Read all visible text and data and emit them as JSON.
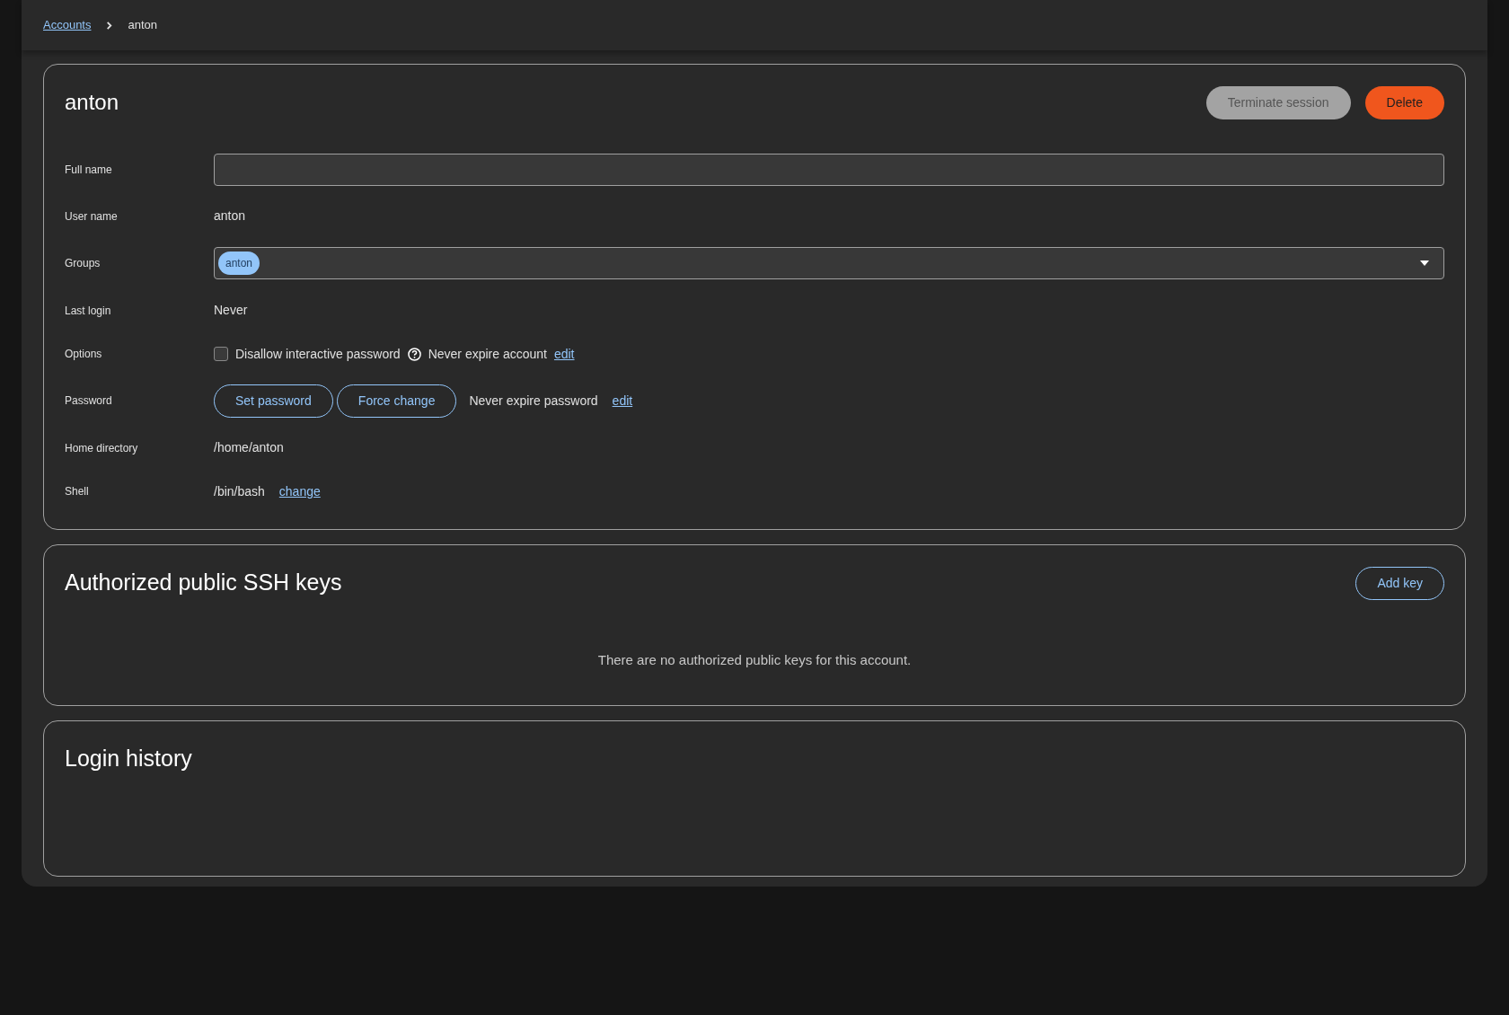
{
  "breadcrumb": {
    "link": "Accounts",
    "current": "anton"
  },
  "account": {
    "title": "anton",
    "actions": [
      {
        "label": "Terminate session",
        "kind": "secondary",
        "disabled": true
      },
      {
        "label": "Delete",
        "kind": "danger",
        "disabled": false
      }
    ],
    "rows": [
      {
        "label": "Full name",
        "kind": "input"
      },
      {
        "label": "User name",
        "kind": "text",
        "value": "anton"
      },
      {
        "label": "Groups",
        "kind": "select",
        "chips": [
          "anton"
        ]
      },
      {
        "label": "Last login",
        "kind": "text",
        "value": "Never"
      },
      {
        "label": "Options",
        "kind": "options",
        "checkbox": {
          "label": "Disallow interactive password",
          "checked": false
        },
        "text": "Never expire account",
        "link": "edit"
      },
      {
        "label": "Password",
        "kind": "password",
        "buttons": [
          "Set password",
          "Force change"
        ],
        "text": "Never expire password",
        "link": "edit"
      },
      {
        "label": "Home directory",
        "kind": "text",
        "value": "/home/anton"
      },
      {
        "label": "Shell",
        "kind": "shell",
        "value": "/bin/bash",
        "link": "change"
      }
    ]
  },
  "ssh_keys": {
    "title": "Authorized public SSH keys",
    "button": "Add key",
    "empty_text": "There are no authorized public keys for this account."
  },
  "login_history": {
    "title": "Login history"
  }
}
